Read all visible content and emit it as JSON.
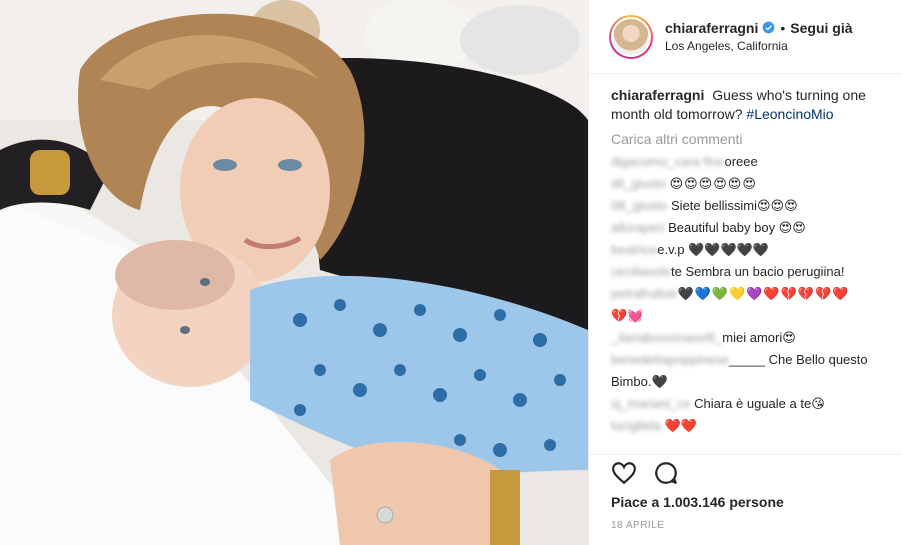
{
  "header": {
    "username": "chiaraferragni",
    "separator": "•",
    "follow_label": "Segui già",
    "location": "Los Angeles, California"
  },
  "caption": {
    "username": "chiaraferragni",
    "text": "Guess who's turning one month old tomorrow?",
    "hashtag": "#LeoncinoMio"
  },
  "load_more_label": "Carica altri commenti",
  "comments": [
    {
      "user": "digacomo_cara fino",
      "text": "oreee"
    },
    {
      "user": "dil_giusto",
      "text": "😍😍😍😍😍😍"
    },
    {
      "user": "08_giusto",
      "text": "Siete bellissimi😍😍😍"
    },
    {
      "user": "alloraperi",
      "text": "Beautiful baby boy 😍😍"
    },
    {
      "user": "beatrice",
      "text": "e.v.p 🖤🖤🖤🖤🖤"
    },
    {
      "user": "ceciliasolo",
      "text": "te Sembra un bacio perugiina!"
    },
    {
      "user": "petrafruttoir",
      "text": "🖤💙💚💛💜❤️💔💔💔❤️"
    },
    {
      "user": "",
      "text": "💔💓"
    },
    {
      "user": "_ilariabonomaselli_",
      "text": "miei amori😍"
    },
    {
      "user": "benedettapoppinese",
      "text": "_____ Che Bello questo"
    },
    {
      "user": "",
      "text": "Bimbo.🖤"
    },
    {
      "user": "sj_mariani_cx",
      "text": "Chiara è uguale a te😘"
    },
    {
      "user": "lucigliela",
      "text": "❤️❤️"
    }
  ],
  "likes_text": "Piace a 1.003.146 persone",
  "date_text": "18 APRILE",
  "icons": {
    "verified": "verified-badge-icon",
    "like": "heart-outline-icon",
    "comment": "comment-bubble-icon"
  },
  "colors": {
    "verified_blue": "#3897f0",
    "hashtag": "#003569",
    "muted": "#999999"
  }
}
